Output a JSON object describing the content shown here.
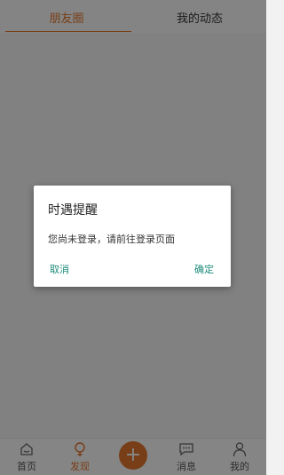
{
  "tabs": [
    {
      "label": "朋友圈",
      "active": true
    },
    {
      "label": "我的动态",
      "active": false
    }
  ],
  "bottom_nav": [
    {
      "label": "首页",
      "icon": "home-icon"
    },
    {
      "label": "发现",
      "icon": "discover-icon",
      "active": true
    },
    {
      "label": "+",
      "icon": "add-icon"
    },
    {
      "label": "消息",
      "icon": "message-icon"
    },
    {
      "label": "我的",
      "icon": "profile-icon"
    }
  ],
  "dialog": {
    "title": "时遇提醒",
    "message": "您尚未登录，请前往登录页面",
    "cancel_label": "取消",
    "confirm_label": "确定"
  },
  "colors": {
    "accent": "#e0762e",
    "dialog_button": "#1d8c7a",
    "overlay": "rgba(0,0,0,0.47)"
  }
}
